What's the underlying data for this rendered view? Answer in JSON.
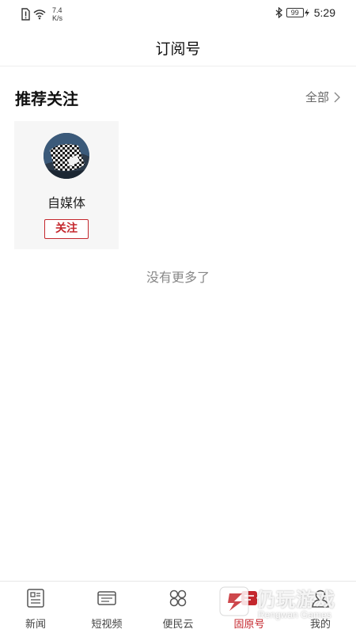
{
  "status_bar": {
    "net_speed_value": "7.4",
    "net_speed_unit": "K/s",
    "battery_level": "99",
    "time": "5:29"
  },
  "header": {
    "title": "订阅号"
  },
  "recommend": {
    "title": "推荐关注",
    "see_all_label": "全部",
    "accounts": [
      {
        "name": "自媒体",
        "follow_label": "关注"
      }
    ]
  },
  "list_end_text": "没有更多了",
  "tabs": [
    {
      "label": "新闻",
      "icon": "newspaper-icon",
      "active": false
    },
    {
      "label": "短视频",
      "icon": "video-icon",
      "active": false
    },
    {
      "label": "便民云",
      "icon": "grid-icon",
      "active": false
    },
    {
      "label": "固原号",
      "icon": "subscription-icon",
      "active": true
    },
    {
      "label": "我的",
      "icon": "user-icon",
      "active": false
    }
  ],
  "watermark": {
    "text": "仍玩游戏",
    "subtext": "Rengwan Games"
  },
  "colors": {
    "accent": "#c4272d",
    "muted_text": "#888888",
    "card_bg": "#f6f6f6"
  }
}
